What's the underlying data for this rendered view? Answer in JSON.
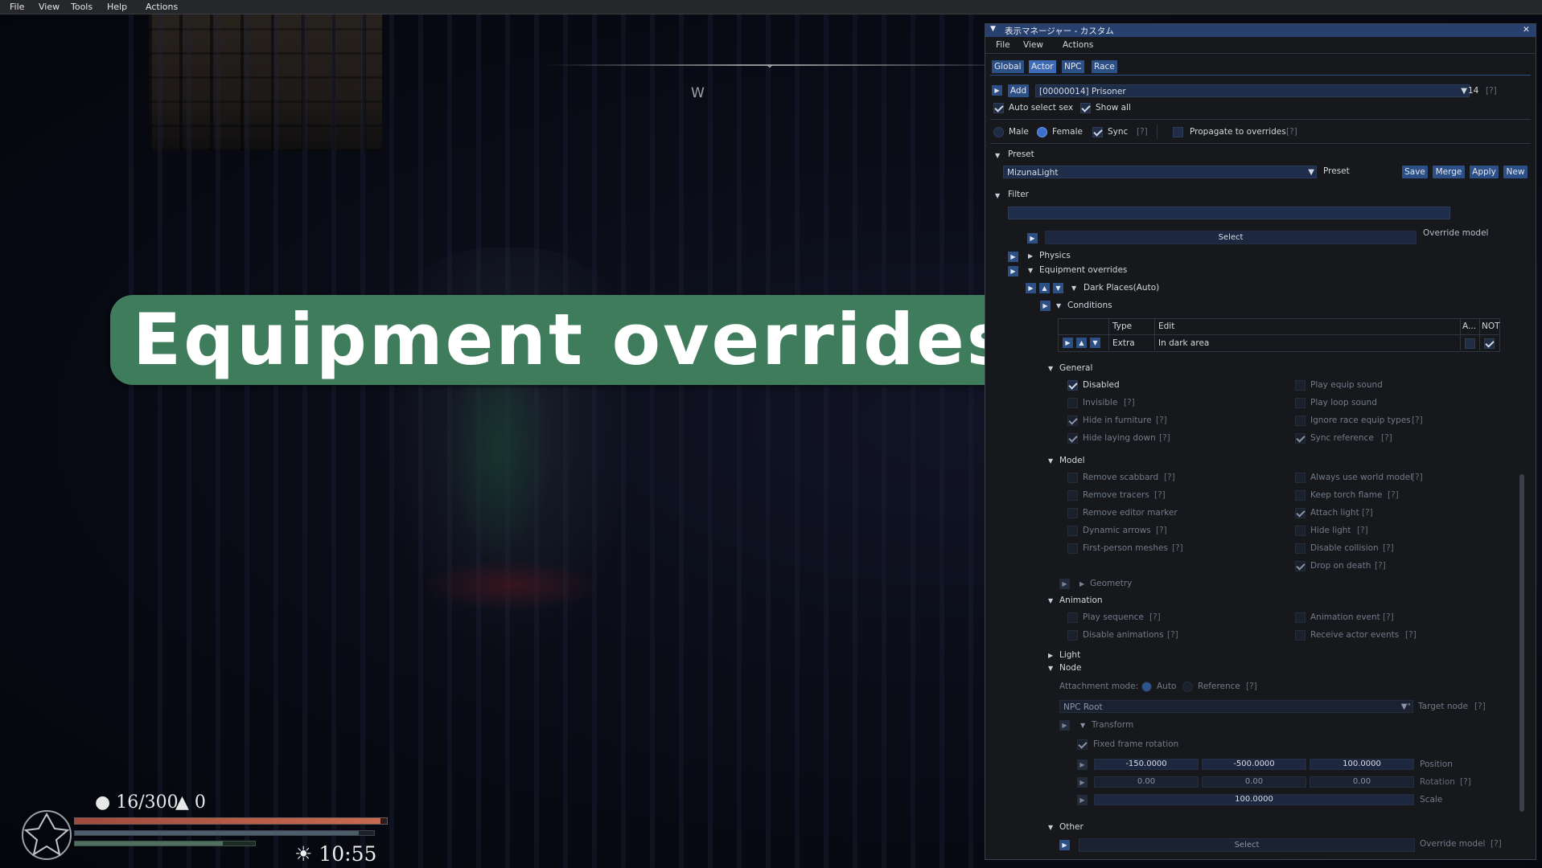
{
  "topbar": {
    "file": "File",
    "view": "View",
    "tools": "Tools",
    "help": "Help",
    "actions": "Actions"
  },
  "game": {
    "compass_heading": "W",
    "banner": "Equipment overrides→"
  },
  "hud": {
    "carry": "16/300",
    "gold": "0",
    "time": "10:55",
    "health_fraction": 0.98,
    "magicka_fraction": 0.95,
    "stamina_fraction": 0.82
  },
  "panel": {
    "title": "表示マネージャー - カスタム",
    "menu": {
      "file": "File",
      "view": "View",
      "actions": "Actions"
    },
    "tabs": [
      "Global",
      "Actor",
      "NPC",
      "Race"
    ],
    "add_label": "Add",
    "actor_select": "[00000014] Prisoner",
    "actor_count": "14",
    "help": "[?]",
    "auto_select_sex": "Auto select sex",
    "show_all": "Show all",
    "male": "Male",
    "female": "Female",
    "sync": "Sync",
    "propagate": "Propagate to overrides",
    "preset_header": "Preset",
    "preset_select": "MizunaLight",
    "preset_label": "Preset",
    "save": "Save",
    "merge": "Merge",
    "apply": "Apply",
    "new": "New",
    "filter_header": "Filter",
    "select_label": "Select",
    "override_model_label": "Override model",
    "physics": "Physics",
    "equipment_overrides": "Equipment overrides",
    "dark_places": "Dark Places(Auto)",
    "conditions": "Conditions",
    "cond_table": {
      "col_type": "Type",
      "col_edit": "Edit",
      "col_a": "A...",
      "col_not": "NOT",
      "row_type": "Extra",
      "row_edit": "In dark area"
    },
    "general": "General",
    "general_left": [
      "Disabled",
      "Invisible",
      "Hide in furniture",
      "Hide laying down"
    ],
    "general_right": [
      "Play equip sound",
      "Play loop sound",
      "Ignore race equip types",
      "Sync reference"
    ],
    "model": "Model",
    "model_left": [
      "Remove scabbard",
      "Remove tracers",
      "Remove editor marker",
      "Dynamic arrows",
      "First-person meshes"
    ],
    "model_right": [
      "Always use world model",
      "Keep torch flame",
      "Attach light",
      "Hide light",
      "Disable collision",
      "Drop on death"
    ],
    "geometry": "Geometry",
    "animation": "Animation",
    "animation_left": [
      "Play sequence",
      "Disable animations"
    ],
    "animation_right": [
      "Animation event",
      "Receive actor events"
    ],
    "light": "Light",
    "node": "Node",
    "attachment_mode": "Attachment mode:",
    "auto": "Auto",
    "reference": "Reference",
    "npc_root": "NPC Root",
    "target_node": "Target node",
    "transform": "Transform",
    "fixed_frame_rotation": "Fixed frame rotation",
    "position": {
      "label": "Position",
      "x": "-150.0000",
      "y": "-500.0000",
      "z": "100.0000"
    },
    "rotation": {
      "label": "Rotation",
      "x": "0.00",
      "y": "0.00",
      "z": "0.00"
    },
    "scale": {
      "label": "Scale",
      "value": "100.0000"
    },
    "other": "Other"
  },
  "colors": {
    "accent": "#2c4f86",
    "title_bar": "#27406e",
    "banner": "#3f7c5c"
  }
}
